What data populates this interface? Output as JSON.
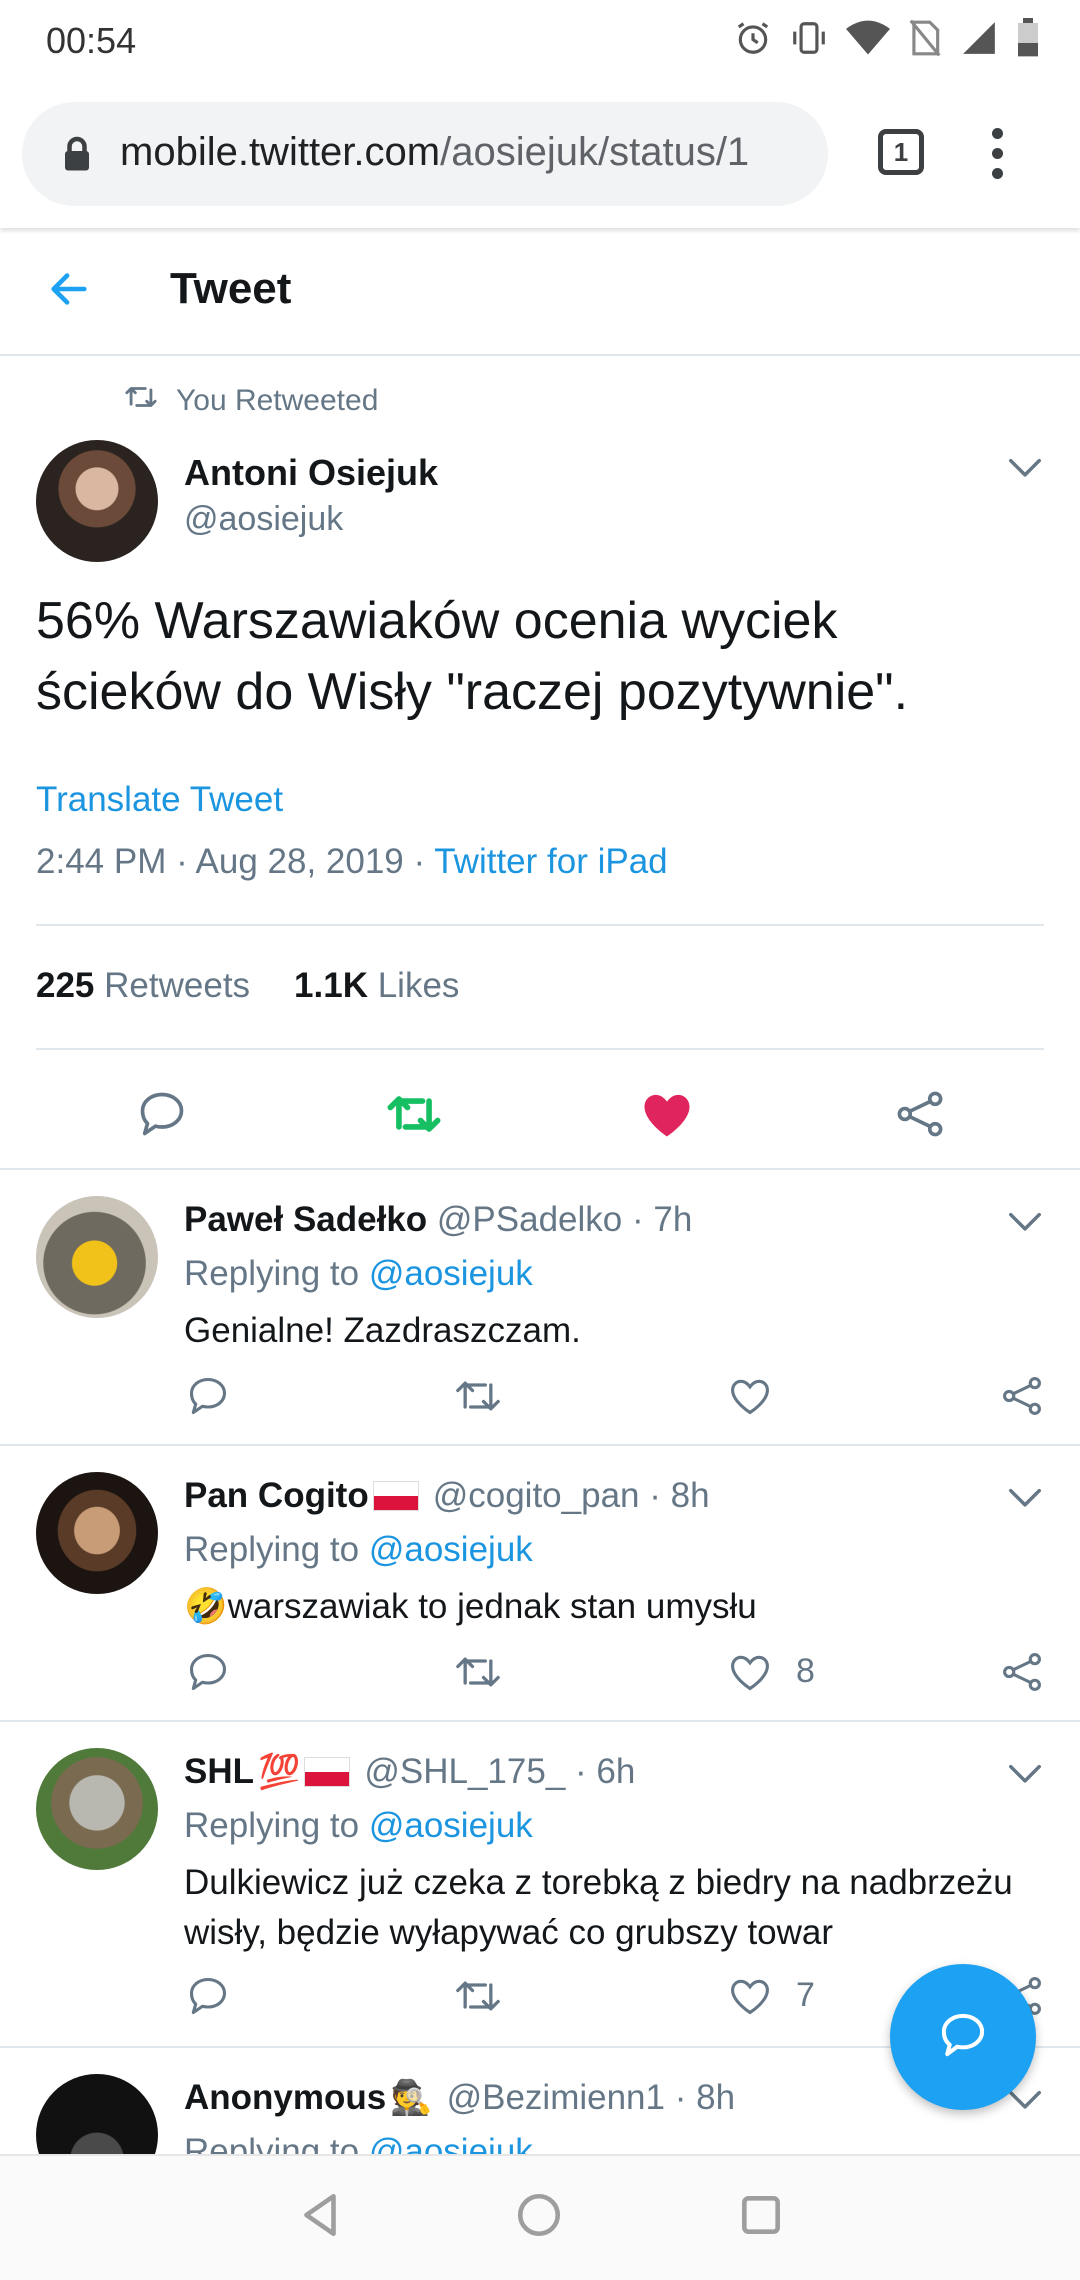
{
  "status_bar": {
    "time": "00:54"
  },
  "browser": {
    "url_host": "mobile.twitter.com",
    "url_path": "/aosiejuk/status/1",
    "tab_count": "1"
  },
  "header": {
    "title": "Tweet"
  },
  "main_tweet": {
    "retweet_note": "You Retweeted",
    "name": "Antoni Osiejuk",
    "handle": "@aosiejuk",
    "text": "56% Warszawiaków ocenia wyciek ścieków do Wisły \"raczej pozytywnie\".",
    "translate": "Translate Tweet",
    "time": "2:44 PM · Aug 28, 2019 · ",
    "source": "Twitter for iPad",
    "retweets_count": "225",
    "retweets_label": "Retweets",
    "likes_count": "1.1K",
    "likes_label": "Likes",
    "liked": true,
    "retweeted": true
  },
  "replies": [
    {
      "name": "Paweł Sadełko",
      "badges": "",
      "flag": false,
      "handle": "@PSadelko",
      "age": "· 7h",
      "replying_prefix": "Replying to",
      "replying_to": "@aosiejuk",
      "text": "Genialne! Zazdraszczam.",
      "likes": ""
    },
    {
      "name": "Pan Cogito",
      "badges": "",
      "flag": true,
      "handle": "@cogito_pan",
      "age": "· 8h",
      "replying_prefix": "Replying to",
      "replying_to": "@aosiejuk",
      "text_emoji": "🤣",
      "text": "warszawiak to jednak stan umysłu",
      "likes": "8"
    },
    {
      "name": "SHL",
      "badges": "💯",
      "flag": true,
      "handle": "@SHL_175_",
      "age": "· 6h",
      "replying_prefix": "Replying to",
      "replying_to": "@aosiejuk",
      "text": "Dulkiewicz już czeka z torebką z biedry na nadbrzeżu wisły, będzie wyłapywać co grubszy towar",
      "likes": "7"
    },
    {
      "name": "Anonymous",
      "badges": "🕵",
      "flag": false,
      "handle": "@Bezimienn1",
      "age": "· 8h",
      "replying_prefix": "Replying to",
      "replying_to": "@aosiejuk"
    }
  ],
  "colors": {
    "accent": "#1da1f2",
    "like": "#e0245e",
    "retweet": "#17bf63",
    "muted": "#657786"
  },
  "icons": [
    "back-arrow-icon",
    "retweet-icon",
    "reply-icon",
    "heart-icon",
    "share-icon",
    "compose-reply-icon",
    "lock-icon",
    "chevron-down-icon"
  ]
}
